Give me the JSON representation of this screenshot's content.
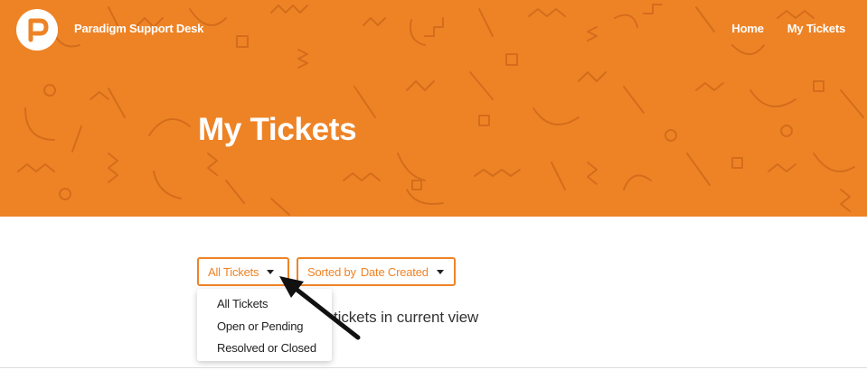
{
  "header": {
    "brand_name": "Paradigm Support Desk",
    "nav": [
      {
        "label": "Home"
      },
      {
        "label": "My Tickets"
      }
    ],
    "page_title": "My Tickets",
    "background_color": "#ee8326"
  },
  "filters": {
    "status_button": {
      "label": "All Tickets",
      "icon": "caret-down-icon"
    },
    "sort_button": {
      "prefix": "Sorted by",
      "value": "Date Created",
      "icon": "caret-down-icon"
    }
  },
  "status_dropdown": {
    "options": [
      "All Tickets",
      "Open or Pending",
      "Resolved or Closed"
    ]
  },
  "content": {
    "empty_message": "y tickets in current view"
  },
  "annotation": {
    "icon": "pointer-arrow-icon",
    "color": "#111111"
  }
}
